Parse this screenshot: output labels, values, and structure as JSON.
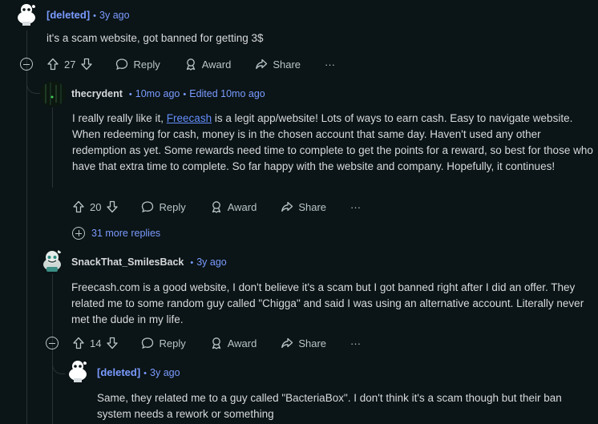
{
  "comments": [
    {
      "author": "[deleted]",
      "time": "3y ago",
      "body": "it's a scam website, got banned for getting 3$",
      "votes": "27",
      "reply_label": "Reply",
      "award_label": "Award",
      "share_label": "Share",
      "more_label": "···"
    },
    {
      "author": "thecrydent",
      "time": "10mo ago",
      "edited": "Edited 10mo ago",
      "body_pre": "I really really like it, ",
      "body_link": "Freecash",
      "body_post": " is a legit app/website! Lots of ways to earn cash. Easy to navigate website. When redeeming for cash, money is in the chosen account that same day. Haven't used any other redemption as yet. Some rewards need time to complete to get the points for a reward, so best for those who have that extra time to complete. So far happy with the website and company. Hopefully, it continues!",
      "votes": "20",
      "reply_label": "Reply",
      "award_label": "Award",
      "share_label": "Share",
      "more_label": "···",
      "more_replies": "31 more replies"
    },
    {
      "author": "SnackThat_SmilesBack",
      "time": "3y ago",
      "body": "Freecash.com is a good website, I don't believe it's a scam but I got banned right after I did an offer. They related me to some random guy called \"Chigga\" and said I was using an alternative account. Literally never met the dude in my life.",
      "votes": "14",
      "reply_label": "Reply",
      "award_label": "Award",
      "share_label": "Share",
      "more_label": "···"
    },
    {
      "author": "[deleted]",
      "time": "3y ago",
      "body": "Same, they related me to a guy called \"BacteriaBox\". I don't think it's a scam though but their ban system needs a rework or something"
    }
  ],
  "colors": {
    "background": "#0b1416",
    "link": "#648efc",
    "meta": "#7a9bff",
    "text": "#d7dadc"
  }
}
